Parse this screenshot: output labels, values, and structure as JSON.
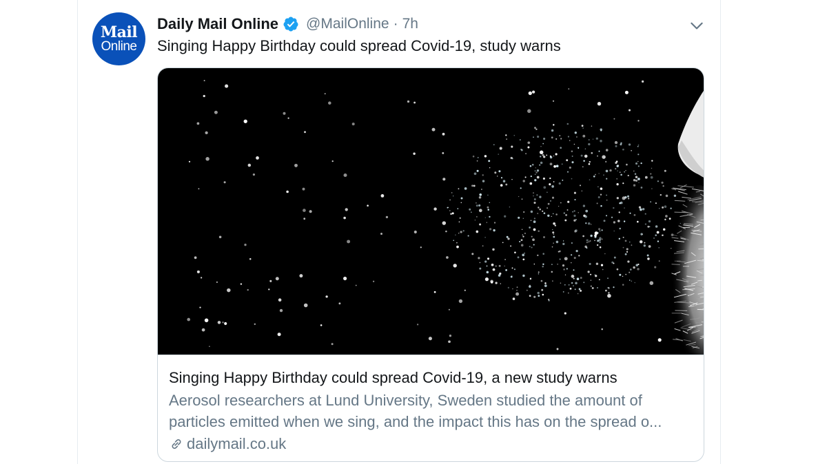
{
  "tweet": {
    "avatar": {
      "line1": "Mail",
      "line2": "Online",
      "color": "#0a51b9"
    },
    "display_name": "Daily Mail Online",
    "verified": true,
    "handle": "@MailOnline",
    "separator": "·",
    "time": "7h",
    "text": "Singing Happy Birthday could spread Covid-19, study warns",
    "menu_icon": "chevron-down-icon"
  },
  "card": {
    "image_description_icon": "aerosol-particles-photo",
    "title": "Singing Happy Birthday could spread Covid-19, a new study warns",
    "description": "Aerosol researchers at Lund University, Sweden studied the amount of particles emitted when we sing, and the impact this has on the spread o...",
    "domain": "dailymail.co.uk",
    "link_icon": "link-icon"
  },
  "colors": {
    "text_primary": "#14171a",
    "text_secondary": "#657786",
    "verified_blue": "#1da1f2",
    "border": "#ccd6dd"
  }
}
